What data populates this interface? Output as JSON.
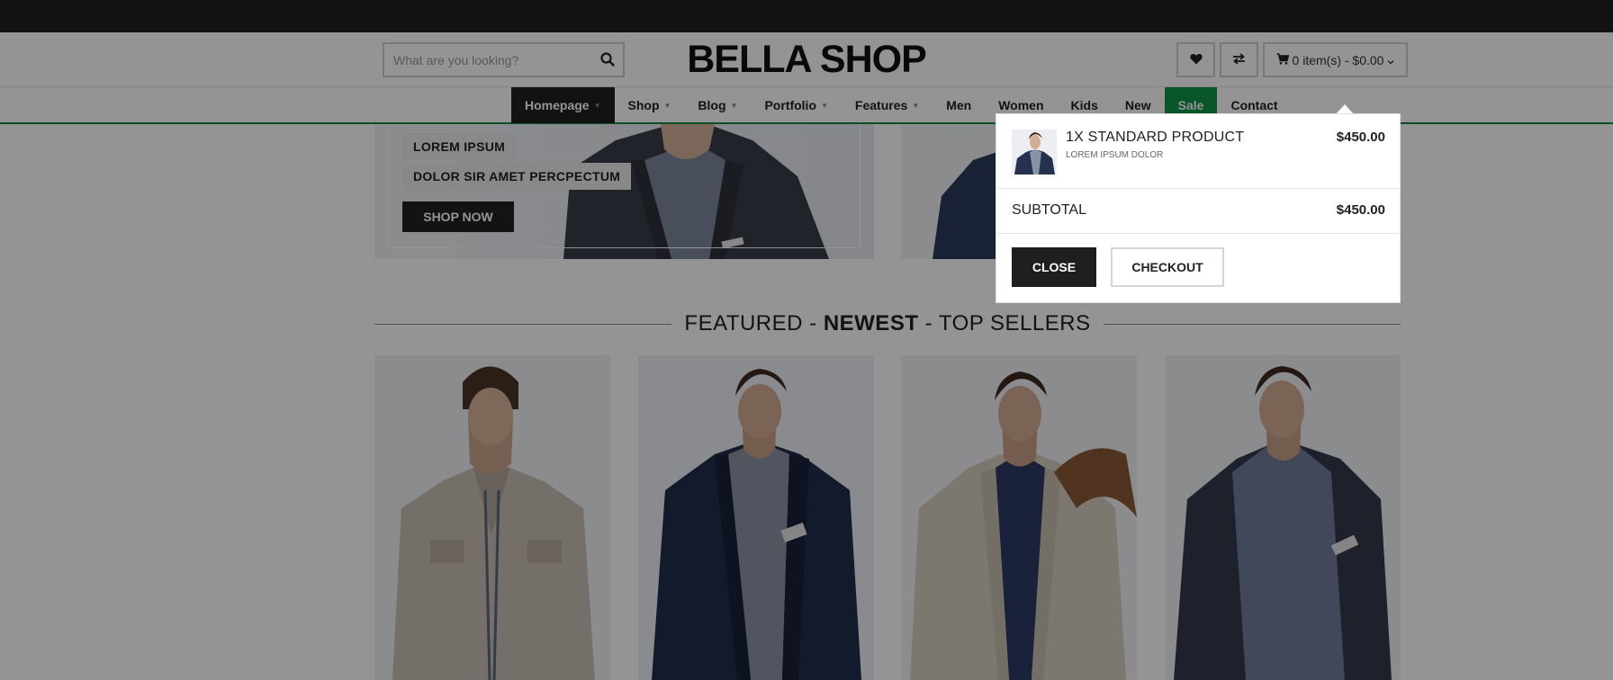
{
  "header": {
    "search_placeholder": "What are you looking?",
    "logo": "BELLA SHOP",
    "cart_summary": "0 item(s) - $0.00"
  },
  "nav": {
    "items": [
      {
        "label": "Homepage",
        "caret": "▼"
      },
      {
        "label": "Shop",
        "caret": "▼"
      },
      {
        "label": "Blog",
        "caret": "▼"
      },
      {
        "label": "Portfolio",
        "caret": "▼"
      },
      {
        "label": "Features",
        "caret": "▼"
      },
      {
        "label": "Men"
      },
      {
        "label": "Women"
      },
      {
        "label": "Kids"
      },
      {
        "label": "New"
      },
      {
        "label": "Sale"
      },
      {
        "label": "Contact"
      }
    ]
  },
  "banner": {
    "tag1": "LOREM IPSUM",
    "tag2": "DOLOR SIR AMET PERCPECTUM",
    "button": "SHOP NOW"
  },
  "featured": {
    "left": "FEATURED",
    "sep1": " - ",
    "middle": "NEWEST",
    "sep2": " - ",
    "right": "TOP SELLERS"
  },
  "cart_popup": {
    "item_title": "1X STANDARD PRODUCT",
    "item_subtitle": "LOREM IPSUM DOLOR",
    "item_price": "$450.00",
    "subtotal_label": "SUBTOTAL",
    "subtotal_value": "$450.00",
    "close_label": "CLOSE",
    "checkout_label": "CHECKOUT"
  },
  "colors": {
    "accent_green": "#10944a",
    "dark": "#1f1f1f",
    "topbar": "#202020"
  },
  "icons": [
    "search-icon",
    "heart-icon",
    "exchange-icon",
    "cart-icon",
    "chevron-down-icon"
  ]
}
